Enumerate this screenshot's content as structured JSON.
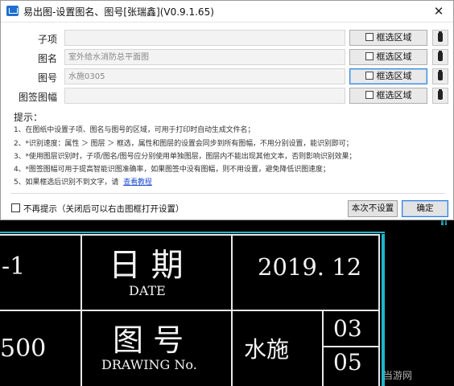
{
  "window": {
    "title": "易出图-设置图名、图号[张瑞鑫](V0.9.1.65)",
    "close_label": "✕"
  },
  "fields": [
    {
      "label": "子项",
      "value": "",
      "select_label": "框选区域",
      "active": false
    },
    {
      "label": "图名",
      "value": "室外给水消防总平面图",
      "select_label": "框选区域",
      "active": false
    },
    {
      "label": "图号",
      "value": "水施0305",
      "select_label": "框选区域",
      "active": true
    },
    {
      "label": "图签图幅",
      "value": "",
      "select_label": "框选区域",
      "active": false
    }
  ],
  "tips": {
    "title": "提示：",
    "lines": [
      "1、在图纸中设置子项、图名与图号的区域，可用于打印时自动生成文件名；",
      "2、*识别速度：属性 ＞ 图层 ＞ 框选，属性和图层的设置会同步到所有图幅，不用分别设置，能识别即可；",
      "3、*使用图层识别时，子项/图名/图号应分别使用单独图层，图层内不能出现其他文本，否则影响识别效果；",
      "4、*图签图幅可用于提高智能识图准确率，如果图签中没有图幅，则不用设置，避免降低识图速度；",
      "5、如果框选后识别不到文字，请"
    ],
    "link": "查看教程"
  },
  "footer": {
    "no_tip_label": "不再提示（关闭后可以右击图框打开设置）",
    "skip_label": "本次不设置",
    "confirm_label": "确定"
  },
  "drawing": {
    "left_num_top": "-1",
    "date_cn": "日 期",
    "date_en": "DATE",
    "date_value": "2019. 12",
    "left_num_bottom": "500",
    "drawing_cn": "图 号",
    "drawing_en": "DRAWING No.",
    "drawing_prefix": "水施",
    "drawing_num_top": "03",
    "drawing_num_bottom": "05"
  },
  "watermark": "当游网",
  "colors": {
    "accent": "#1f6fd0",
    "cad_cyan": "#1fb6c9",
    "link": "#1f4fd0"
  }
}
